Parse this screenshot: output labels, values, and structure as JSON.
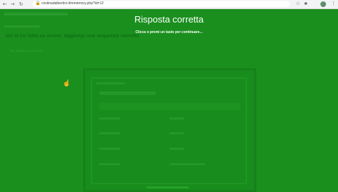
{
  "browser": {
    "back_icon": "←",
    "forward_icon": "→",
    "reload_icon": "↻",
    "lock_icon": "🔒",
    "url": "cristinadalbertini.it/mmemory.php?id=12",
    "star_icon": "☆",
    "extensions_icon": "♣",
    "menu_icon": "⋮"
  },
  "overlay": {
    "title": "Risposta corretta",
    "subtitle": "Clicca o premi un tasto per continuare..."
  },
  "page": {
    "heading": "Ieri io ho fatto un errore. Aggiungi una sequenza corretta",
    "subline": "Sul livello successivo"
  },
  "colors": {
    "overlay_green": "#1a8f1e",
    "text_white": "#ffffff"
  }
}
